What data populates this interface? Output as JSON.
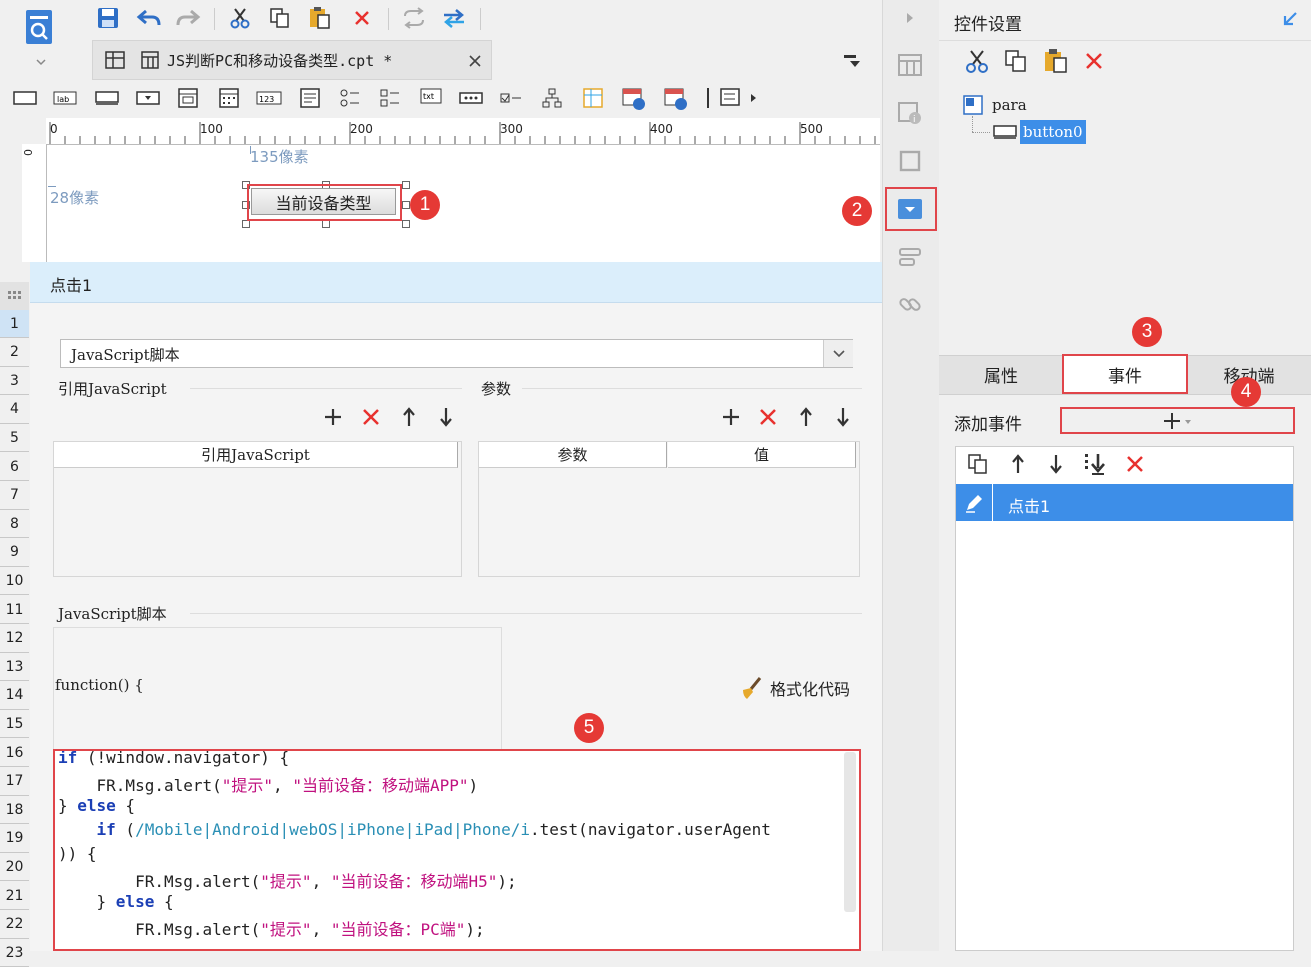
{
  "editor": {
    "tab_title": "JS判断PC和移动设备类型.cpt *",
    "ruler_ticks": [
      "0",
      "100",
      "200",
      "300",
      "400",
      "500"
    ],
    "label_width": "135像素",
    "label_height": "28像素",
    "canvas_button": "当前设备类型"
  },
  "event_panel": {
    "title": "点击1",
    "script_type": "JavaScript脚本",
    "ref_js_section": "引用JavaScript",
    "params_section": "参数",
    "ref_js_col": "引用JavaScript",
    "param_col": "参数",
    "value_col": "值",
    "js_section": "JavaScript脚本",
    "function_sig": "function() {",
    "format_code": "格式化代码"
  },
  "row_numbers": [
    "1",
    "2",
    "3",
    "4",
    "5",
    "6",
    "7",
    "8",
    "9",
    "10",
    "11",
    "12",
    "13",
    "14",
    "15",
    "16",
    "17",
    "18",
    "19",
    "20",
    "21",
    "22",
    "23"
  ],
  "code": {
    "l1_if": "if",
    "l1_rest": " (!window.navigator) {",
    "l2_a": "    FR.Msg.alert(",
    "l2_s1": "\"提示\"",
    "l2_b": ", ",
    "l2_s2": "\"当前设备：移动端APP\"",
    "l2_c": ")",
    "l3_a": "} ",
    "l3_else": "else",
    "l3_b": " {",
    "l4_if": "    if",
    "l4_a": " (",
    "l4_re": "/Mobile|Android|webOS|iPhone|iPad|Phone/i",
    "l4_b": ".test(navigator.userAgent",
    "l5": ")) {",
    "l6_a": "        FR.Msg.alert(",
    "l6_s1": "\"提示\"",
    "l6_b": ", ",
    "l6_s2": "\"当前设备：移动端H5\"",
    "l6_c": ");",
    "l7_a": "    } ",
    "l7_else": "else",
    "l7_b": " {",
    "l8_a": "        FR.Msg.alert(",
    "l8_s1": "\"提示\"",
    "l8_b": ", ",
    "l8_s2": "\"当前设备：PC端\"",
    "l8_c": ");"
  },
  "right_panel": {
    "title": "控件设置",
    "tree_root": "para",
    "tree_child": "button0",
    "tab_properties": "属性",
    "tab_events": "事件",
    "tab_mobile": "移动端",
    "add_event_label": "添加事件",
    "event_item": "点击1"
  },
  "badges": [
    "1",
    "2",
    "3",
    "4",
    "5"
  ],
  "colors": {
    "accent": "#3d8ee8",
    "selected_bg": "#3d8ee8",
    "badge_red": "#e53935",
    "header_blue": "#dbeefb",
    "delete_red": "#e8312e"
  }
}
